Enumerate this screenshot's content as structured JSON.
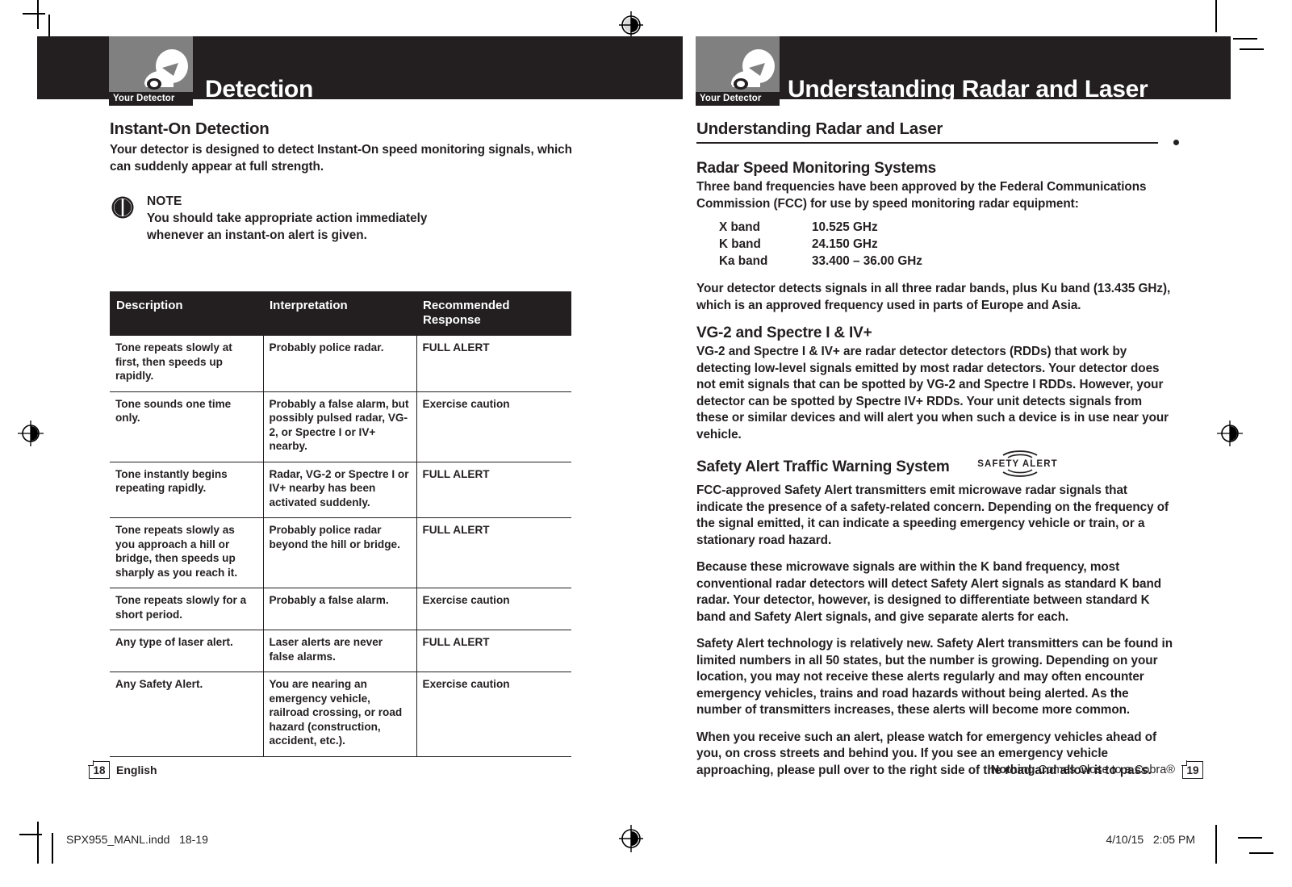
{
  "document": {
    "type": "printed-manual-spread",
    "accent_dark": "#231f20",
    "chip_gray": "#808080"
  },
  "left_page": {
    "header": {
      "chip_caption": "Your Detector",
      "chip_icon": "radar-detector-icon",
      "title": "Detection"
    },
    "section": {
      "title": "Instant-On Detection",
      "intro_before": "Your detector is designed to detect ",
      "intro_bold": "Instant-On",
      "intro_after": " speed monitoring signals, which can suddenly appear at full strength."
    },
    "note": {
      "icon": "note-circle-icon",
      "label": "NOTE",
      "line1": "You should take appropriate action immediately",
      "line2": "whenever an instant-on alert is given."
    },
    "table": {
      "columns": [
        "Description",
        "Interpretation",
        "Recommended Response"
      ],
      "rows": [
        {
          "description": "Tone repeats slowly at first, then speeds up rapidly.",
          "interpretation": "Probably police radar.",
          "response": "FULL ALERT"
        },
        {
          "description": "Tone sounds one time only.",
          "interpretation": "Probably a false alarm, but possibly pulsed radar, VG-2, or Spectre I or IV+ nearby.",
          "response": "Exercise caution"
        },
        {
          "description": "Tone instantly begins repeating rapidly.",
          "interpretation": "Radar, VG-2 or Spectre I or IV+ nearby has been activated suddenly.",
          "response": "FULL ALERT"
        },
        {
          "description": "Tone repeats slowly as you approach a hill or bridge, then speeds up sharply as you reach it.",
          "interpretation": "Probably police radar beyond the hill or bridge.",
          "response": "FULL ALERT"
        },
        {
          "description": "Tone repeats slowly for a short period.",
          "interpretation": "Probably a false alarm.",
          "response": "Exercise caution"
        },
        {
          "description": "Any type of laser alert.",
          "interpretation": "Laser alerts are never false alarms.",
          "response": "FULL ALERT"
        },
        {
          "description": "Any Safety Alert.",
          "interpretation": "You are nearing an emergency vehicle, railroad crossing, or road hazard (construction, accident, etc.).",
          "response": "Exercise caution"
        }
      ]
    },
    "footer": {
      "page_number": "18",
      "language": "English"
    }
  },
  "right_page": {
    "header": {
      "chip_caption": "Your Detector",
      "chip_icon": "radar-detector-icon",
      "title": "Understanding Radar and Laser"
    },
    "section_title": "Understanding Radar and Laser",
    "radar_systems": {
      "heading": "Radar Speed Monitoring Systems",
      "paragraph": "Three band frequencies have been approved by the Federal Communications Commission (FCC) for use by speed monitoring radar equipment:",
      "bands": [
        {
          "name": "X band",
          "frequency": "10.525 GHz"
        },
        {
          "name": "K band",
          "frequency": "24.150 GHz"
        },
        {
          "name": "Ka band",
          "frequency": "33.400 – 36.00 GHz"
        }
      ],
      "after_bands": "Your detector detects signals in all three radar bands, plus Ku band (13.435 GHz), which is an approved frequency used in parts of Europe and Asia."
    },
    "vg2": {
      "heading": "VG-2 and Spectre I & IV+",
      "bold1": "VG-2",
      "mid1": " and ",
      "bold2": "Spectre I & IV+",
      "rest": " are radar detector detectors (RDDs) that work by detecting low-level signals emitted by most radar detectors. Your detector does not emit signals that can be spotted by VG-2 and Spectre I RDDs. However, your detector can be spotted by Spectre IV+ RDDs. Your unit detects signals from these or similar devices and will alert you when such a device is in use near your vehicle."
    },
    "safety_alert": {
      "heading": "Safety Alert Traffic Warning System",
      "logo_text": "SAFETY ALERT",
      "logo_icon": "safety-alert-logo",
      "p1_before": "FCC-approved ",
      "p1_bold": "Safety Alert",
      "p1_after": " transmitters emit microwave radar signals that indicate the presence of a safety-related concern. Depending on the frequency of the signal emitted, it can indicate a speeding emergency vehicle or train, or a stationary road hazard.",
      "p2": "Because these microwave signals are within the K band frequency, most conventional radar detectors will detect Safety Alert signals as standard K band radar. Your detector, however, is designed to differentiate between standard K band and Safety Alert signals, and give separate alerts for each.",
      "p3": "Safety Alert technology is relatively new. Safety Alert transmitters can be found in limited numbers in all 50 states, but the number is growing. Depending on your location, you may not receive these alerts regularly and may often encounter emergency vehicles, trains and road hazards without being alerted. As the number of transmitters increases, these alerts will become more common.",
      "p4": "When you receive such an alert, please watch for emergency vehicles ahead of you, on cross streets and behind you. If you see an emergency vehicle approaching, please pull over to the right side of the road and allow it to pass."
    },
    "footer": {
      "tagline_bold": "Nothing",
      "tagline_rest": " Comes Close to a Cobra®",
      "page_number": "19"
    }
  },
  "print_marks": {
    "filename": "SPX955_MANL.indd   18-19",
    "timestamp": "4/10/15   2:05 PM"
  }
}
